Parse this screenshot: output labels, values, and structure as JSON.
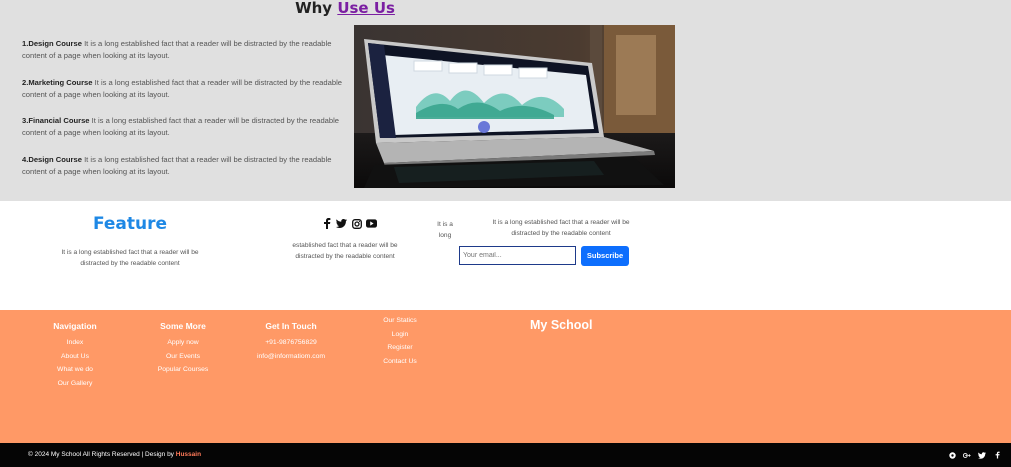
{
  "why": {
    "title_main": "Why",
    "title_highlight": "Use Us",
    "courses": [
      {
        "name": "1.Design Course",
        "text": "It is a long established fact that a reader will be distracted by the readable content of a page when looking at its layout."
      },
      {
        "name": "2.Marketing Course",
        "text": "It is a long established fact that a reader will be distracted by the readable content of a page when looking at its layout."
      },
      {
        "name": "3.Financial Course",
        "text": "It is a long established fact that a reader will be distracted by the readable content of a page when looking at its layout."
      },
      {
        "name": "4.Design Course",
        "text": "It is a long established fact that a reader will be distracted by the readable content of a page when looking at its layout."
      }
    ],
    "image_icon": "laptop-dashboard-photo"
  },
  "feature": {
    "title": "Feature",
    "text": "It is a long established fact that a reader will be distracted by the readable content",
    "mid_text": "established fact that a reader will be distracted by the readable content",
    "small_text": "It is a long",
    "subscribe_text": "It is a long established fact that a reader will be distracted by the readable content",
    "email_placeholder": "Your email...",
    "subscribe_label": "Subscribe",
    "social_icons": [
      "facebook-icon",
      "twitter-icon",
      "instagram-icon",
      "youtube-icon"
    ]
  },
  "footer": {
    "navigation": {
      "title": "Navigation",
      "items": [
        "Index",
        "About Us",
        "What we do",
        "Our Gallery"
      ]
    },
    "more": {
      "title": "Some More",
      "items": [
        "Apply now",
        "Our Events",
        "Popular Courses"
      ]
    },
    "contact": {
      "title": "Get In Touch",
      "items": [
        "+91-9876756829",
        "info@informatiom.com"
      ]
    },
    "extra": {
      "items": [
        "Our Statics",
        "Login",
        "Register",
        "Contact Us"
      ]
    },
    "brand": "My School",
    "color": "#ff9966"
  },
  "bottom": {
    "copyright": "© 2024 My School All Rights Reserved | Design by",
    "author": "Hussain",
    "icons": [
      "globe-icon",
      "google-plus-icon",
      "twitter-icon",
      "facebook-icon"
    ]
  }
}
